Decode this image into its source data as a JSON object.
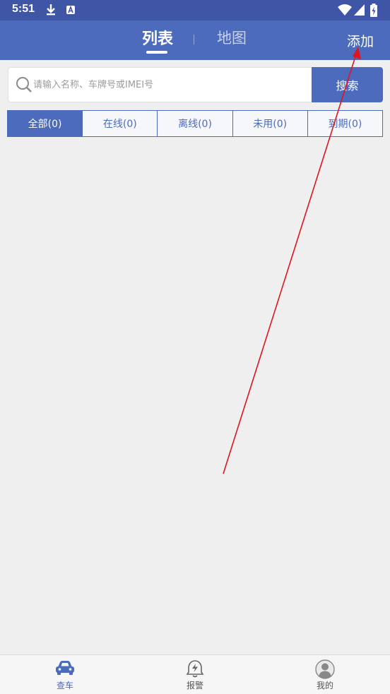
{
  "status_bar": {
    "time": "5:51"
  },
  "header": {
    "tabs": [
      {
        "label": "列表",
        "active": true
      },
      {
        "label": "地图",
        "active": false
      }
    ],
    "add_label": "添加"
  },
  "search": {
    "placeholder": "请输入名称、车牌号或IMEI号",
    "button_label": "搜索"
  },
  "filters": [
    {
      "label": "全部(0)",
      "active": true
    },
    {
      "label": "在线(0)",
      "active": false
    },
    {
      "label": "离线(0)",
      "active": false
    },
    {
      "label": "未用(0)",
      "active": false
    },
    {
      "label": "到期(0)",
      "active": false
    }
  ],
  "bottom_nav": [
    {
      "label": "查车",
      "icon": "car-icon",
      "active": true
    },
    {
      "label": "报警",
      "icon": "alarm-bell-icon",
      "active": false
    },
    {
      "label": "我的",
      "icon": "profile-icon",
      "active": false
    }
  ],
  "colors": {
    "accent": "#4d6bbd",
    "status_bar": "#3f55a5",
    "background": "#efefef",
    "annotation": "#e0141e"
  }
}
